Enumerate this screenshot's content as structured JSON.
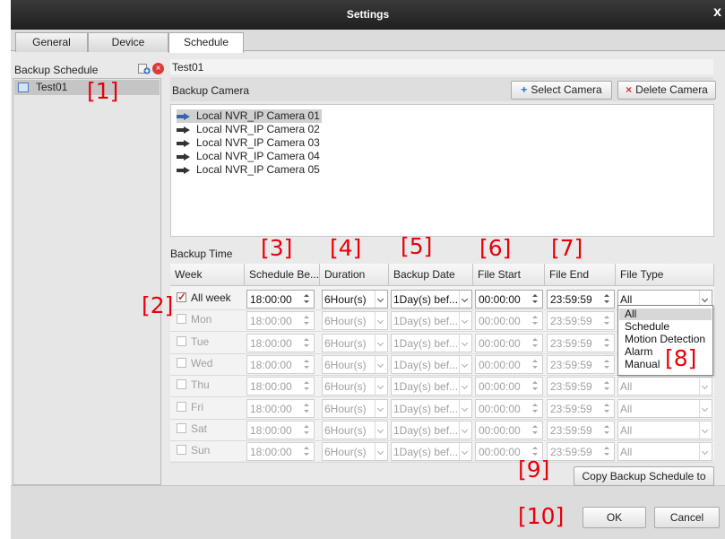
{
  "window": {
    "title": "Settings",
    "close_glyph": "x"
  },
  "tabs": [
    {
      "label": "General",
      "active": false
    },
    {
      "label": "Device",
      "active": false
    },
    {
      "label": "Schedule",
      "active": true
    }
  ],
  "left_panel": {
    "heading": "Backup Schedule",
    "add_icon": "add-schedule-icon",
    "delete_icon": "delete-schedule-icon",
    "items": [
      {
        "label": "Test01",
        "selected": true
      }
    ]
  },
  "schedule_name": "Test01",
  "backup_camera": {
    "label": "Backup Camera",
    "select_button": "Select Camera",
    "delete_button": "Delete Camera",
    "cameras": [
      {
        "label": "Local NVR_IP Camera 01",
        "selected": true
      },
      {
        "label": "Local NVR_IP Camera 02",
        "selected": false
      },
      {
        "label": "Local NVR_IP Camera 03",
        "selected": false
      },
      {
        "label": "Local NVR_IP Camera 04",
        "selected": false
      },
      {
        "label": "Local NVR_IP Camera 05",
        "selected": false
      }
    ]
  },
  "backup_time": {
    "label": "Backup Time",
    "columns": [
      "Week",
      "Schedule Be...",
      "Duration",
      "Backup Date",
      "File Start",
      "File End",
      "File Type"
    ],
    "rows": [
      {
        "week": "All week",
        "checked": true,
        "schedule_begin": "18:00:00",
        "duration": "6Hour(s)",
        "backup_date": "1Day(s) bef...",
        "file_start": "00:00:00",
        "file_end": "23:59:59",
        "file_type": "All"
      },
      {
        "week": "Mon",
        "checked": false,
        "schedule_begin": "18:00:00",
        "duration": "6Hour(s)",
        "backup_date": "1Day(s) bef...",
        "file_start": "00:00:00",
        "file_end": "23:59:59",
        "file_type": "All"
      },
      {
        "week": "Tue",
        "checked": false,
        "schedule_begin": "18:00:00",
        "duration": "6Hour(s)",
        "backup_date": "1Day(s) bef...",
        "file_start": "00:00:00",
        "file_end": "23:59:59",
        "file_type": "All"
      },
      {
        "week": "Wed",
        "checked": false,
        "schedule_begin": "18:00:00",
        "duration": "6Hour(s)",
        "backup_date": "1Day(s) bef...",
        "file_start": "00:00:00",
        "file_end": "23:59:59",
        "file_type": "All"
      },
      {
        "week": "Thu",
        "checked": false,
        "schedule_begin": "18:00:00",
        "duration": "6Hour(s)",
        "backup_date": "1Day(s) bef...",
        "file_start": "00:00:00",
        "file_end": "23:59:59",
        "file_type": "All"
      },
      {
        "week": "Fri",
        "checked": false,
        "schedule_begin": "18:00:00",
        "duration": "6Hour(s)",
        "backup_date": "1Day(s) bef...",
        "file_start": "00:00:00",
        "file_end": "23:59:59",
        "file_type": "All"
      },
      {
        "week": "Sat",
        "checked": false,
        "schedule_begin": "18:00:00",
        "duration": "6Hour(s)",
        "backup_date": "1Day(s) bef...",
        "file_start": "00:00:00",
        "file_end": "23:59:59",
        "file_type": "All"
      },
      {
        "week": "Sun",
        "checked": false,
        "schedule_begin": "18:00:00",
        "duration": "6Hour(s)",
        "backup_date": "1Day(s) bef...",
        "file_start": "00:00:00",
        "file_end": "23:59:59",
        "file_type": "All"
      }
    ],
    "file_type_options": [
      "All",
      "Schedule",
      "Motion Detection",
      "Alarm",
      "Manual"
    ],
    "file_type_highlighted": "All"
  },
  "copy_button": "Copy Backup Schedule to",
  "ok_button": "OK",
  "cancel_button": "Cancel",
  "annotations": [
    "[1]",
    "[2]",
    "[3]",
    "[4]",
    "[5]",
    "[6]",
    "[7]",
    "[8]",
    "[9]",
    "[10]"
  ],
  "colors": {
    "annotation": "#e8000b",
    "titlebar": "#2b2b2b",
    "checkmark": "#d82323",
    "add_icon": "#2d6fc4"
  }
}
